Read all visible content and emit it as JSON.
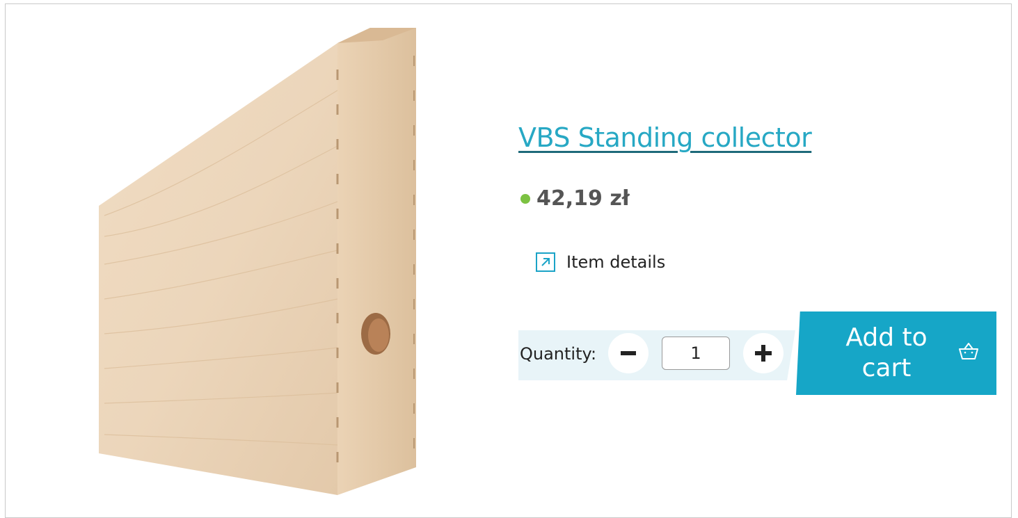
{
  "product": {
    "title": "VBS Standing collector",
    "price": "42,19 zł",
    "availability_color": "#7cc242",
    "image_icon": "wooden-magazine-file-image"
  },
  "details": {
    "label": "Item details",
    "icon": "external-arrow-icon"
  },
  "quantity": {
    "label": "Quantity:",
    "value": "1",
    "decrease_icon": "minus-icon",
    "increase_icon": "plus-icon"
  },
  "cart": {
    "label_line1": "Add to",
    "label_line2": "cart",
    "icon": "basket-icon"
  },
  "colors": {
    "accent": "#16a6c7",
    "title": "#27a8c4",
    "panel": "#e8f4f8"
  }
}
